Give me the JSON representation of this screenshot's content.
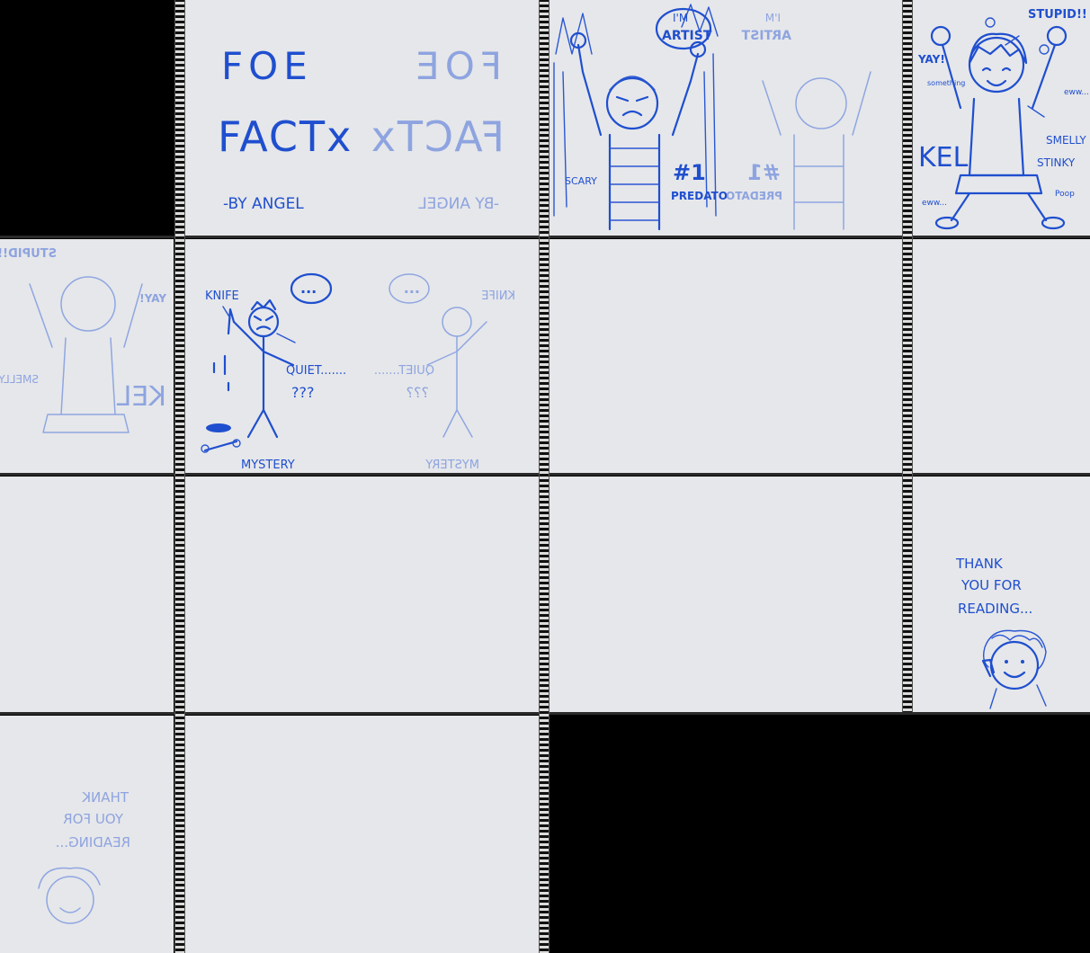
{
  "cover": {
    "title_line1": "FOE",
    "title_line2": "FACTx",
    "byline": "-BY ANGEL"
  },
  "artist_page": {
    "bubble_line1": "I'M",
    "bubble_line2": "ARTIST",
    "rank": "#1",
    "label": "PREDATOR",
    "scary": "SCARY"
  },
  "kel_page": {
    "name": "KEL",
    "stupid": "STUPID!!",
    "yay": "YAY!",
    "smelly": "SMELLY",
    "stinky": "STINKY",
    "ewww": "eww...",
    "poop": "Poop",
    "something": "something"
  },
  "mystery_page": {
    "knife": "KNIFE",
    "quiet": "QUIET.......",
    "questions": "???",
    "mystery": "MYSTERY",
    "speech": "..."
  },
  "ending_page": {
    "line1": "THANK",
    "line2": "YOU FOR",
    "line3": "READING..."
  },
  "colors": {
    "ink": "#1f4fcf",
    "paper": "#e6e7ea",
    "background": "#000000"
  }
}
